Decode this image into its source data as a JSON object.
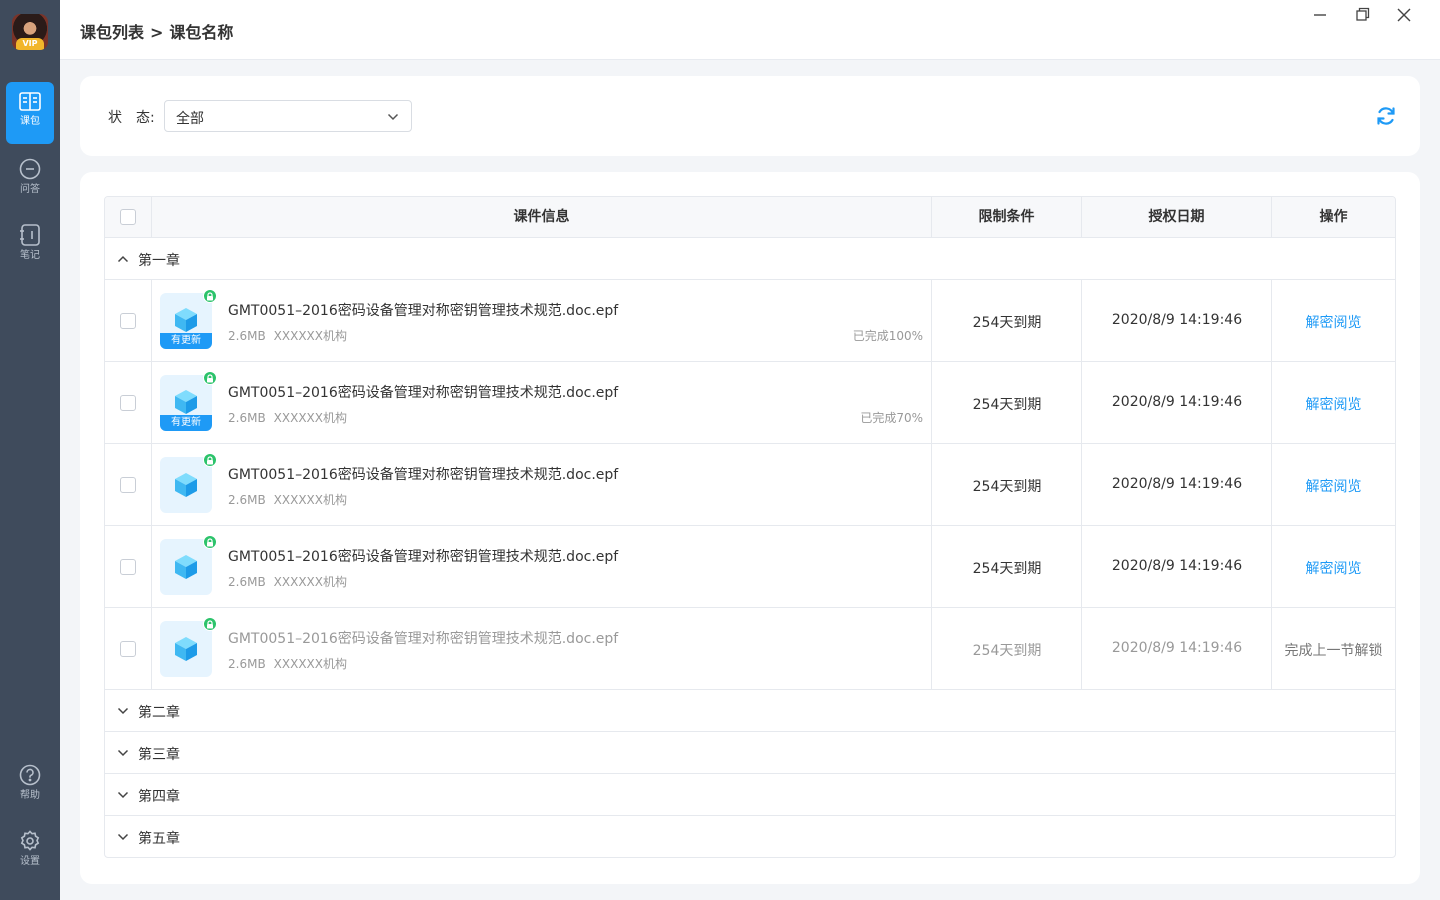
{
  "sidebar": {
    "avatar_badge": "VIP",
    "items": [
      {
        "label": "课包",
        "icon": "book-icon",
        "active": true
      },
      {
        "label": "问答",
        "icon": "chat-icon",
        "active": false
      },
      {
        "label": "笔记",
        "icon": "notebook-icon",
        "active": false
      },
      {
        "label": "帮助",
        "icon": "help-icon",
        "active": false
      },
      {
        "label": "设置",
        "icon": "gear-icon",
        "active": false
      }
    ]
  },
  "header": {
    "breadcrumb": [
      "课包列表",
      ">",
      "课包名称"
    ]
  },
  "filter": {
    "label": "状　态:",
    "selected": "全部"
  },
  "table": {
    "columns": [
      "课件信息",
      "限制条件",
      "授权日期",
      "操作"
    ],
    "chapters": [
      {
        "title": "第一章",
        "expanded": true,
        "rows": [
          {
            "name": "GMT0051–2016密码设备管理对称密钥管理技术规范.doc.epf",
            "size": "2.6MB",
            "org": "XXXXXX机构",
            "progress": "已完成100%",
            "update_tag": "有更新",
            "limit": "254天到期",
            "date": "2020/8/9 14:19:46",
            "action": "解密阅览",
            "locked": false
          },
          {
            "name": "GMT0051–2016密码设备管理对称密钥管理技术规范.doc.epf",
            "size": "2.6MB",
            "org": "XXXXXX机构",
            "progress": "已完成70%",
            "update_tag": "有更新",
            "limit": "254天到期",
            "date": "2020/8/9 14:19:46",
            "action": "解密阅览",
            "locked": false
          },
          {
            "name": "GMT0051–2016密码设备管理对称密钥管理技术规范.doc.epf",
            "size": "2.6MB",
            "org": "XXXXXX机构",
            "progress": "",
            "update_tag": "",
            "limit": "254天到期",
            "date": "2020/8/9 14:19:46",
            "action": "解密阅览",
            "locked": false
          },
          {
            "name": "GMT0051–2016密码设备管理对称密钥管理技术规范.doc.epf",
            "size": "2.6MB",
            "org": "XXXXXX机构",
            "progress": "",
            "update_tag": "",
            "limit": "254天到期",
            "date": "2020/8/9 14:19:46",
            "action": "解密阅览",
            "locked": false
          },
          {
            "name": "GMT0051–2016密码设备管理对称密钥管理技术规范.doc.epf",
            "size": "2.6MB",
            "org": "XXXXXX机构",
            "progress": "",
            "update_tag": "",
            "limit": "254天到期",
            "date": "2020/8/9 14:19:46",
            "action": "完成上一节解锁",
            "locked": true
          }
        ]
      },
      {
        "title": "第二章",
        "expanded": false,
        "rows": []
      },
      {
        "title": "第三章",
        "expanded": false,
        "rows": []
      },
      {
        "title": "第四章",
        "expanded": false,
        "rows": []
      },
      {
        "title": "第五章",
        "expanded": false,
        "rows": []
      }
    ]
  },
  "colors": {
    "accent": "#1e9af6",
    "sidebar": "#3f4b5c",
    "lock_badge": "#2cc36b"
  }
}
